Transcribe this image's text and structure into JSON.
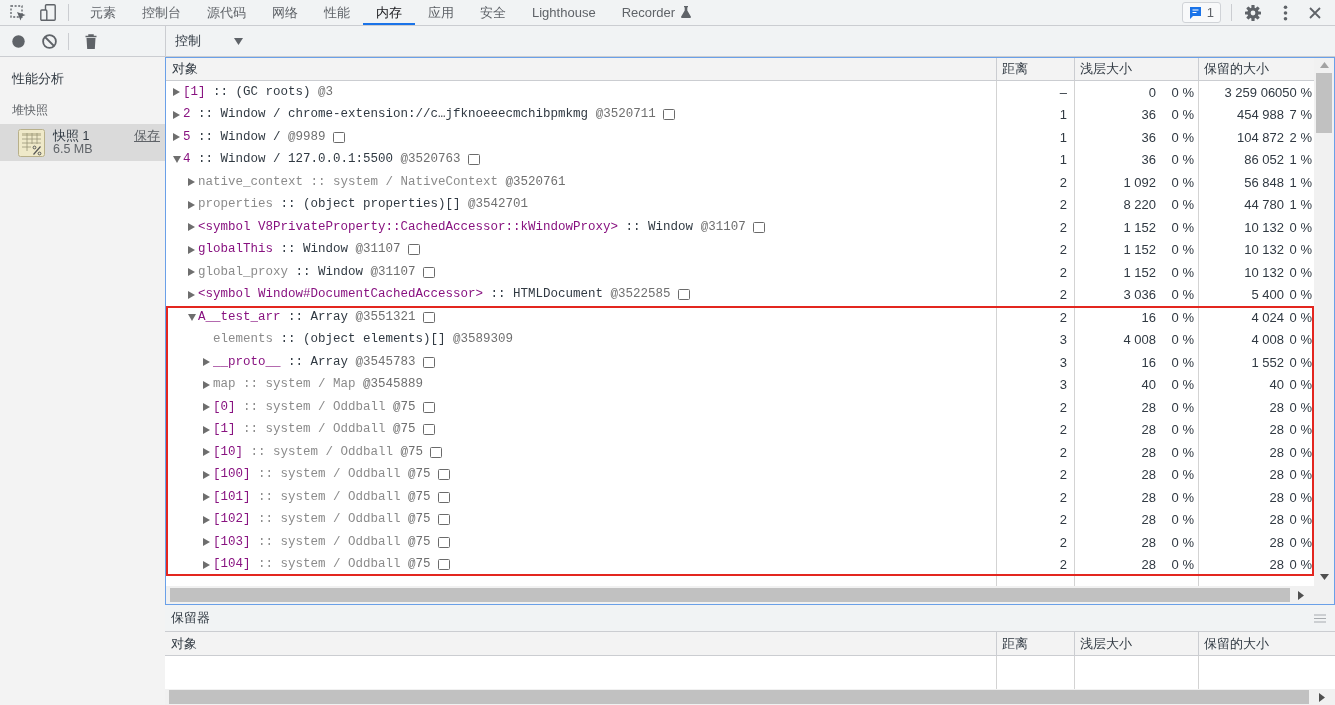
{
  "tabs_bar": {
    "tabs": [
      {
        "label": "元素",
        "selected": false,
        "experimental": false
      },
      {
        "label": "控制台",
        "selected": false,
        "experimental": false
      },
      {
        "label": "源代码",
        "selected": false,
        "experimental": false
      },
      {
        "label": "网络",
        "selected": false,
        "experimental": false
      },
      {
        "label": "性能",
        "selected": false,
        "experimental": false
      },
      {
        "label": "内存",
        "selected": true,
        "experimental": false
      },
      {
        "label": "应用",
        "selected": false,
        "experimental": false
      },
      {
        "label": "安全",
        "selected": false,
        "experimental": false
      },
      {
        "label": "Lighthouse",
        "selected": false,
        "experimental": false
      },
      {
        "label": "Recorder",
        "selected": false,
        "experimental": true
      }
    ],
    "issues_count": "1"
  },
  "view_selector": {
    "value": "控制"
  },
  "sidebar": {
    "title": "性能分析",
    "sections": [
      {
        "label": "堆快照",
        "items": [
          {
            "title": "快照 1",
            "size": "6.5 MB",
            "action": "保存",
            "selected": true
          }
        ]
      }
    ]
  },
  "objects_table": {
    "columns": [
      "对象",
      "距离",
      "浅层大小",
      "保留的大小"
    ],
    "rows": [
      {
        "label": [
          {
            "kind": "property",
            "text": "[1]"
          },
          {
            "kind": "class",
            "text": ":: (GC roots)"
          },
          {
            "kind": "id",
            "text": "@3"
          }
        ],
        "box_icon": false,
        "expandable": true,
        "expanded": false,
        "highlighted": false,
        "distance": "–",
        "shallow_size": "0",
        "shallow_percent": "0 %",
        "retained_size": "3 259 060",
        "retained_percent": "50 %"
      },
      {
        "label": [
          {
            "kind": "property",
            "text": "2"
          },
          {
            "kind": "class",
            "text": ":: Window / chrome-extension://c…jfknoeeecmchibpmkmg"
          },
          {
            "kind": "id",
            "text": "@3520711"
          }
        ],
        "box_icon": true,
        "expandable": true,
        "expanded": false,
        "highlighted": false,
        "distance": "1",
        "shallow_size": "36",
        "shallow_percent": "0 %",
        "retained_size": "454 988",
        "retained_percent": "7 %"
      },
      {
        "label": [
          {
            "kind": "property",
            "text": "5"
          },
          {
            "kind": "class",
            "text": ":: Window /"
          },
          {
            "kind": "id",
            "text": "@9989"
          }
        ],
        "box_icon": true,
        "expandable": true,
        "expanded": false,
        "highlighted": false,
        "distance": "1",
        "shallow_size": "36",
        "shallow_percent": "0 %",
        "retained_size": "104 872",
        "retained_percent": "2 %"
      },
      {
        "label": [
          {
            "kind": "property",
            "text": "4"
          },
          {
            "kind": "class",
            "text": ":: Window / 127.0.0.1:5500"
          },
          {
            "kind": "id",
            "text": "@3520763"
          }
        ],
        "box_icon": true,
        "expandable": true,
        "expanded": true,
        "highlighted": false,
        "distance": "1",
        "shallow_size": "36",
        "shallow_percent": "0 %",
        "retained_size": "86 052",
        "retained_percent": "1 %",
        "children": [
          {
            "label": [
              {
                "kind": "internal",
                "text": "native_context"
              },
              {
                "kind": "system",
                "text": ":: system / NativeContext"
              },
              {
                "kind": "id",
                "text": "@3520761"
              }
            ],
            "box_icon": false,
            "expandable": true,
            "expanded": false,
            "highlighted": false,
            "distance": "2",
            "shallow_size": "1 092",
            "shallow_percent": "0 %",
            "retained_size": "56 848",
            "retained_percent": "1 %"
          },
          {
            "label": [
              {
                "kind": "internal",
                "text": "properties"
              },
              {
                "kind": "class",
                "text": ":: (object properties)[]"
              },
              {
                "kind": "id",
                "text": "@3542701"
              }
            ],
            "box_icon": false,
            "expandable": true,
            "expanded": false,
            "highlighted": false,
            "distance": "2",
            "shallow_size": "8 220",
            "shallow_percent": "0 %",
            "retained_size": "44 780",
            "retained_percent": "1 %"
          },
          {
            "label": [
              {
                "kind": "property",
                "text": "<symbol V8PrivateProperty::CachedAccessor::kWindowProxy>"
              },
              {
                "kind": "class",
                "text": ":: Window"
              },
              {
                "kind": "id",
                "text": "@31107"
              }
            ],
            "box_icon": true,
            "expandable": true,
            "expanded": false,
            "highlighted": false,
            "distance": "2",
            "shallow_size": "1 152",
            "shallow_percent": "0 %",
            "retained_size": "10 132",
            "retained_percent": "0 %"
          },
          {
            "label": [
              {
                "kind": "property",
                "text": "globalThis"
              },
              {
                "kind": "class",
                "text": ":: Window"
              },
              {
                "kind": "id",
                "text": "@31107"
              }
            ],
            "box_icon": true,
            "expandable": true,
            "expanded": false,
            "highlighted": false,
            "distance": "2",
            "shallow_size": "1 152",
            "shallow_percent": "0 %",
            "retained_size": "10 132",
            "retained_percent": "0 %"
          },
          {
            "label": [
              {
                "kind": "internal",
                "text": "global_proxy"
              },
              {
                "kind": "class",
                "text": ":: Window"
              },
              {
                "kind": "id",
                "text": "@31107"
              }
            ],
            "box_icon": true,
            "expandable": true,
            "expanded": false,
            "highlighted": false,
            "distance": "2",
            "shallow_size": "1 152",
            "shallow_percent": "0 %",
            "retained_size": "10 132",
            "retained_percent": "0 %"
          },
          {
            "label": [
              {
                "kind": "property",
                "text": "<symbol Window#DocumentCachedAccessor>"
              },
              {
                "kind": "class",
                "text": ":: HTMLDocument"
              },
              {
                "kind": "id",
                "text": "@3522585"
              }
            ],
            "box_icon": true,
            "expandable": true,
            "expanded": false,
            "highlighted": false,
            "distance": "2",
            "shallow_size": "3 036",
            "shallow_percent": "0 %",
            "retained_size": "5 400",
            "retained_percent": "0 %"
          },
          {
            "label": [
              {
                "kind": "property",
                "text": "A__test_arr"
              },
              {
                "kind": "class",
                "text": ":: Array"
              },
              {
                "kind": "id",
                "text": "@3551321"
              }
            ],
            "box_icon": true,
            "expandable": true,
            "expanded": true,
            "highlighted": true,
            "distance": "2",
            "shallow_size": "16",
            "shallow_percent": "0 %",
            "retained_size": "4 024",
            "retained_percent": "0 %",
            "children": [
              {
                "label": [
                  {
                    "kind": "internal",
                    "text": "elements"
                  },
                  {
                    "kind": "class",
                    "text": ":: (object elements)[]"
                  },
                  {
                    "kind": "id",
                    "text": "@3589309"
                  }
                ],
                "box_icon": false,
                "expandable": false,
                "highlighted": false,
                "distance": "3",
                "shallow_size": "4 008",
                "shallow_percent": "0 %",
                "retained_size": "4 008",
                "retained_percent": "0 %"
              },
              {
                "label": [
                  {
                    "kind": "property",
                    "text": "__proto__"
                  },
                  {
                    "kind": "class",
                    "text": ":: Array"
                  },
                  {
                    "kind": "id",
                    "text": "@3545783"
                  }
                ],
                "box_icon": true,
                "expandable": true,
                "expanded": false,
                "highlighted": false,
                "distance": "3",
                "shallow_size": "16",
                "shallow_percent": "0 %",
                "retained_size": "1 552",
                "retained_percent": "0 %"
              },
              {
                "label": [
                  {
                    "kind": "internal",
                    "text": "map"
                  },
                  {
                    "kind": "system",
                    "text": ":: system / Map"
                  },
                  {
                    "kind": "id",
                    "text": "@3545889"
                  }
                ],
                "box_icon": false,
                "expandable": true,
                "expanded": false,
                "highlighted": false,
                "distance": "3",
                "shallow_size": "40",
                "shallow_percent": "0 %",
                "retained_size": "40",
                "retained_percent": "0 %"
              },
              {
                "label": [
                  {
                    "kind": "property",
                    "text": "[0]"
                  },
                  {
                    "kind": "system",
                    "text": ":: system / Oddball"
                  },
                  {
                    "kind": "id",
                    "text": "@75"
                  }
                ],
                "box_icon": true,
                "expandable": true,
                "expanded": false,
                "highlighted": false,
                "distance": "2",
                "shallow_size": "28",
                "shallow_percent": "0 %",
                "retained_size": "28",
                "retained_percent": "0 %"
              },
              {
                "label": [
                  {
                    "kind": "property",
                    "text": "[1]"
                  },
                  {
                    "kind": "system",
                    "text": ":: system / Oddball"
                  },
                  {
                    "kind": "id",
                    "text": "@75"
                  }
                ],
                "box_icon": true,
                "expandable": true,
                "expanded": false,
                "highlighted": false,
                "distance": "2",
                "shallow_size": "28",
                "shallow_percent": "0 %",
                "retained_size": "28",
                "retained_percent": "0 %"
              },
              {
                "label": [
                  {
                    "kind": "property",
                    "text": "[10]"
                  },
                  {
                    "kind": "system",
                    "text": ":: system / Oddball"
                  },
                  {
                    "kind": "id",
                    "text": "@75"
                  }
                ],
                "box_icon": true,
                "expandable": true,
                "expanded": false,
                "highlighted": false,
                "distance": "2",
                "shallow_size": "28",
                "shallow_percent": "0 %",
                "retained_size": "28",
                "retained_percent": "0 %"
              },
              {
                "label": [
                  {
                    "kind": "property",
                    "text": "[100]"
                  },
                  {
                    "kind": "system",
                    "text": ":: system / Oddball"
                  },
                  {
                    "kind": "id",
                    "text": "@75"
                  }
                ],
                "box_icon": true,
                "expandable": true,
                "expanded": false,
                "highlighted": false,
                "distance": "2",
                "shallow_size": "28",
                "shallow_percent": "0 %",
                "retained_size": "28",
                "retained_percent": "0 %"
              },
              {
                "label": [
                  {
                    "kind": "property",
                    "text": "[101]"
                  },
                  {
                    "kind": "system",
                    "text": ":: system / Oddball"
                  },
                  {
                    "kind": "id",
                    "text": "@75"
                  }
                ],
                "box_icon": true,
                "expandable": true,
                "expanded": false,
                "highlighted": false,
                "distance": "2",
                "shallow_size": "28",
                "shallow_percent": "0 %",
                "retained_size": "28",
                "retained_percent": "0 %"
              },
              {
                "label": [
                  {
                    "kind": "property",
                    "text": "[102]"
                  },
                  {
                    "kind": "system",
                    "text": ":: system / Oddball"
                  },
                  {
                    "kind": "id",
                    "text": "@75"
                  }
                ],
                "box_icon": true,
                "expandable": true,
                "expanded": false,
                "highlighted": false,
                "distance": "2",
                "shallow_size": "28",
                "shallow_percent": "0 %",
                "retained_size": "28",
                "retained_percent": "0 %"
              },
              {
                "label": [
                  {
                    "kind": "property",
                    "text": "[103]"
                  },
                  {
                    "kind": "system",
                    "text": ":: system / Oddball"
                  },
                  {
                    "kind": "id",
                    "text": "@75"
                  }
                ],
                "box_icon": true,
                "expandable": true,
                "expanded": false,
                "highlighted": false,
                "distance": "2",
                "shallow_size": "28",
                "shallow_percent": "0 %",
                "retained_size": "28",
                "retained_percent": "0 %"
              },
              {
                "label": [
                  {
                    "kind": "property",
                    "text": "[104]"
                  },
                  {
                    "kind": "system",
                    "text": ":: system / Oddball"
                  },
                  {
                    "kind": "id",
                    "text": "@75"
                  }
                ],
                "box_icon": true,
                "expandable": true,
                "expanded": false,
                "highlighted": false,
                "distance": "2",
                "shallow_size": "28",
                "shallow_percent": "0 %",
                "retained_size": "28",
                "retained_percent": "0 %"
              }
            ]
          }
        ]
      }
    ]
  },
  "retainers": {
    "title": "保留器",
    "columns": [
      "对象",
      "距离",
      "浅层大小",
      "保留的大小"
    ]
  }
}
